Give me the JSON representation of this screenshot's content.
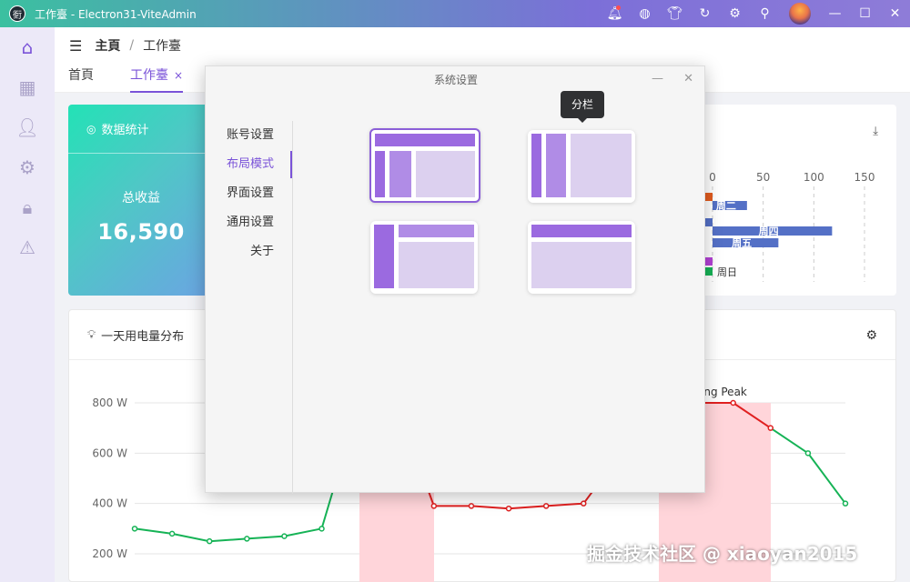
{
  "window": {
    "logo_text": "衐",
    "title": "工作臺 - Electron31-ViteAdmin"
  },
  "titlebar_icons": [
    {
      "name": "bell-icon",
      "glyph": "🔔︎"
    },
    {
      "name": "palette-icon",
      "glyph": "◍"
    },
    {
      "name": "shirt-icon",
      "glyph": "👕︎"
    },
    {
      "name": "refresh-icon",
      "glyph": "↻"
    },
    {
      "name": "settings-icon",
      "glyph": "⚙"
    },
    {
      "name": "pin-icon",
      "glyph": "⚲"
    },
    {
      "name": "minimize-icon",
      "glyph": "—"
    },
    {
      "name": "maximize-icon",
      "glyph": "☐"
    },
    {
      "name": "close-icon",
      "glyph": "✕"
    }
  ],
  "sidebar": [
    {
      "name": "home-icon",
      "glyph": "⌂"
    },
    {
      "name": "grid-icon",
      "glyph": "▦"
    },
    {
      "name": "user-icon",
      "glyph": "👤︎"
    },
    {
      "name": "gear-icon",
      "glyph": "⚙"
    },
    {
      "name": "lock-icon",
      "glyph": "🔒︎"
    },
    {
      "name": "warning-icon",
      "glyph": "⚠"
    }
  ],
  "breadcrumb": {
    "menu_glyph": "☰",
    "root": "主頁",
    "sep": "/",
    "current": "工作臺"
  },
  "tabs": [
    {
      "label": "首頁"
    },
    {
      "label": "工作臺",
      "close": "×"
    }
  ],
  "stats_card": {
    "icon": "◎",
    "title": "数据统计",
    "label": "总收益",
    "value": "16,590"
  },
  "bar_chart": {
    "download_glyph": "⤓"
  },
  "power_card": {
    "icon": "💡︎",
    "title": "一天用电量分布",
    "gear_glyph": "⚙"
  },
  "dialog": {
    "title": "系统设置",
    "min_glyph": "—",
    "close_glyph": "✕",
    "menu": [
      "账号设置",
      "布局模式",
      "界面设置",
      "通用设置",
      "关于"
    ],
    "active_index": 1,
    "tooltip": "分栏"
  },
  "watermark": "掘金技术社区 @ xiaoyan2015",
  "chart_data": [
    {
      "type": "bar",
      "orientation": "horizontal",
      "x_ticks": [
        "0",
        "50",
        "100",
        "150"
      ],
      "xlim": [
        0,
        150
      ],
      "visible_categories": [
        "周二",
        "周四",
        "周五",
        "周日"
      ],
      "values": [
        34,
        118,
        65,
        null
      ],
      "bar_colors": {
        "周二": "#5470c6",
        "周四": "#5470c6",
        "周五": "#5470c6",
        "周日": "#16b356"
      }
    },
    {
      "type": "line",
      "y_ticks": [
        "200 W",
        "400 W",
        "600 W",
        "800 W"
      ],
      "ylim": [
        200,
        800
      ],
      "points": [
        300,
        280,
        250,
        260,
        270,
        300,
        800,
        800,
        390,
        390,
        380,
        390,
        400,
        600,
        800,
        800,
        800,
        700,
        600,
        400
      ],
      "highlight_from_index": 7,
      "highlight_to_index": 17,
      "markarea_label": "ing Peak",
      "line_color": "#16b356",
      "highlight_color": "#e02020",
      "band_color": "#ffd5da"
    }
  ]
}
